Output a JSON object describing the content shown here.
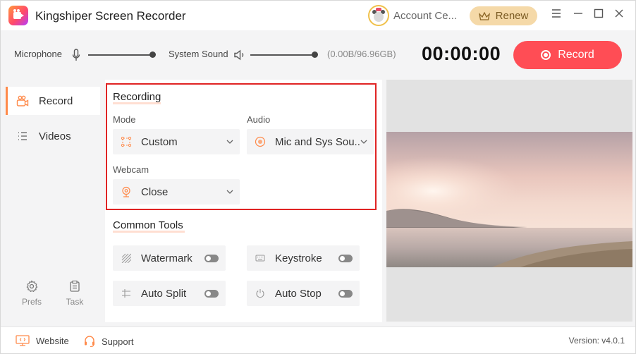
{
  "app": {
    "title": "Kingshiper Screen Recorder",
    "account_label": "Account Ce...",
    "renew_label": "Renew"
  },
  "window_controls": [
    "menu-icon",
    "minimize-icon",
    "maximize-icon",
    "close-icon"
  ],
  "controlbar": {
    "microphone_label": "Microphone",
    "microphone_level": 1.0,
    "system_sound_label": "System Sound",
    "system_sound_level": 1.0,
    "storage": "(0.00B/96.96GB)",
    "timer": "00:00:00",
    "record_label": "Record"
  },
  "sidebar": {
    "items": [
      {
        "label": "Record",
        "icon": "camera-icon",
        "active": true
      },
      {
        "label": "Videos",
        "icon": "list-icon",
        "active": false
      }
    ],
    "bottom": [
      {
        "label": "Prefs",
        "icon": "gear-icon"
      },
      {
        "label": "Task",
        "icon": "clipboard-icon"
      }
    ]
  },
  "recording": {
    "title": "Recording",
    "mode_label": "Mode",
    "mode_value": "Custom",
    "audio_label": "Audio",
    "audio_value": "Mic and Sys Sou...",
    "webcam_label": "Webcam",
    "webcam_value": "Close"
  },
  "common_tools": {
    "title": "Common Tools",
    "tools": [
      {
        "label": "Watermark",
        "icon": "watermark-icon",
        "enabled": false
      },
      {
        "label": "Keystroke",
        "icon": "keyboard-icon",
        "enabled": false
      },
      {
        "label": "Auto Split",
        "icon": "split-icon",
        "enabled": false
      },
      {
        "label": "Auto Stop",
        "icon": "power-icon",
        "enabled": false
      }
    ]
  },
  "footer": {
    "website_label": "Website",
    "support_label": "Support",
    "version": "Version: v4.0.1"
  },
  "colors": {
    "accent": "#ff4d55",
    "orange": "#ff8a4a",
    "highlight_border": "#e02424",
    "renew_bg": "#f5d9a8"
  }
}
